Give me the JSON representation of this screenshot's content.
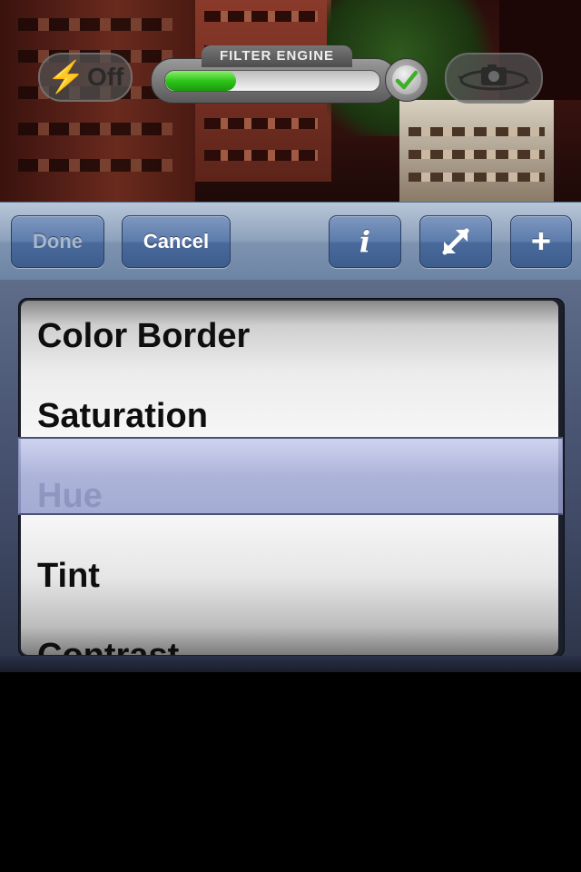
{
  "camera": {
    "flash": {
      "label": "Off",
      "icon": "lightning-icon"
    },
    "filter_engine": {
      "title": "FILTER ENGINE",
      "progress": 0.33,
      "status_icon": "checkmark-icon"
    },
    "switch_camera": {
      "icon": "camera-switch-icon"
    }
  },
  "toolbar": {
    "done_label": "Done",
    "cancel_label": "Cancel",
    "info_label": "i",
    "resize_icon": "resize-arrows-icon",
    "add_label": "+"
  },
  "picker": {
    "items": [
      "Color Border",
      "Saturation",
      "Hue",
      "Tint",
      "Contrast"
    ],
    "selected_index": 2
  },
  "colors": {
    "toolbar": "#8ea2bc",
    "button": "#5c7bab",
    "progress_fill": "#2ec51b",
    "selection": "#a0a8d4"
  }
}
